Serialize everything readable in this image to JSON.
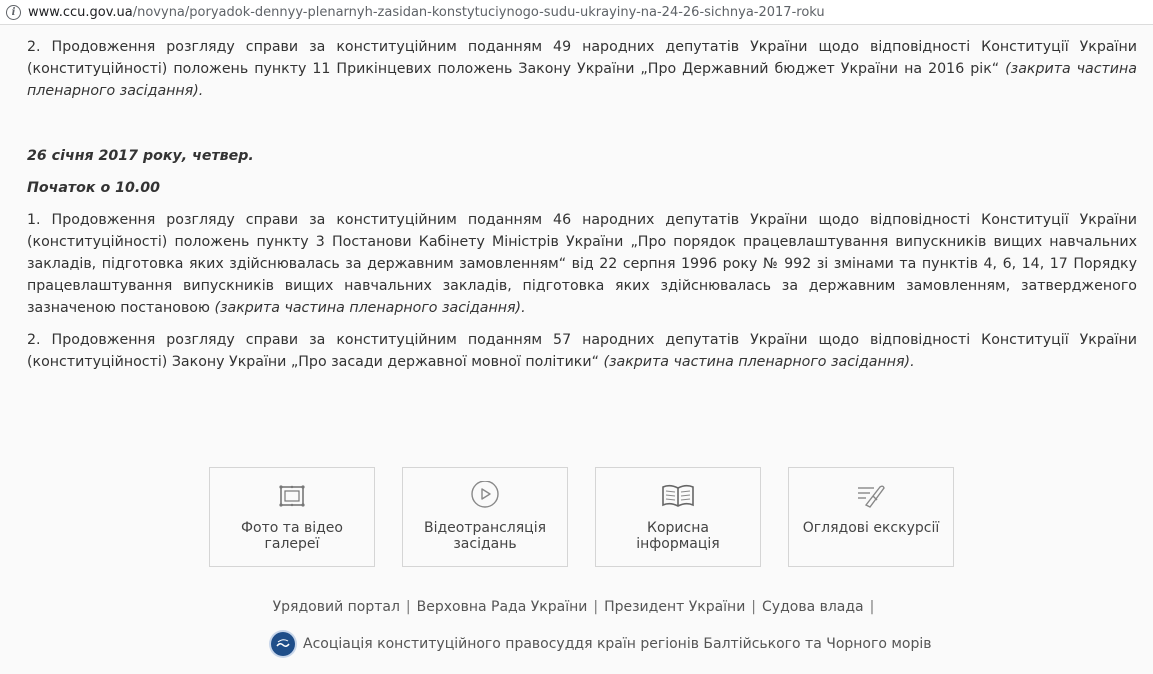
{
  "browser": {
    "url_host": "www.ccu.gov.ua",
    "url_path": "/novyna/poryadok-dennyy-plenarnyh-zasidan-konstytuciynogo-sudu-ukrayiny-na-24-26-sichnya-2017-roku"
  },
  "article": {
    "p2a_text": "2. Продовження розгляду справи за конституційним поданням 49 народних депутатів України щодо відповідності Конституції України (конституційності) положень пункту 11 Прикінцевих положень Закону України „Про Державний бюджет України на 2016 рік“ ",
    "p2a_note": "(закрита частина пленарного засідання).",
    "date_heading": "26 січня 2017 року, четвер.",
    "start_time": "Початок о 10.00",
    "p1_text": "1. Продовження розгляду справи за конституційним поданням 46 народних депутатів України щодо відповідності Конституції України (конституційності) положень пункту 3 Постанови Кабінету Міністрів України „Про порядок працевлаштування випускників вищих навчальних закладів, підготовка яких здійснювалась за державним замовленням“ від 22 серпня 1996 року №  992 зі змінами та пунктів 4, 6, 14, 17 Порядку працевлаштування випускників вищих навчальних закладів, підготовка яких здійснювалась за державним замовленням, затвердженого зазначеною постановою ",
    "p1_note": "(закрита частина пленарного засідання).",
    "p2b_text": "2. Продовження розгляду справи за конституційним поданням 57 народних депутатів України щодо відповідності Конституції України (конституційності) Закону України „Про засади державної мовної політики“ ",
    "p2b_note": "(закрита частина пленарного засідання)."
  },
  "tiles": [
    {
      "label_line1": "Фото та відео",
      "label_line2": "галереї",
      "icon": "photo-frame-icon"
    },
    {
      "label_line1": "Відеотрансляція",
      "label_line2": "засідань",
      "icon": "play-circle-icon"
    },
    {
      "label_line1": "Корисна",
      "label_line2": "інформація",
      "icon": "open-book-icon"
    },
    {
      "label_line1": "Оглядові екскурсії",
      "label_line2": "",
      "icon": "ticket-pen-icon"
    }
  ],
  "footer": {
    "links": [
      "Урядовий портал",
      "Верховна Рада України",
      "Президент України",
      "Судова влада"
    ],
    "separator": "|",
    "association": "Асоціація конституційного правосуддя країн регіонів Балтійського та Чорного морів",
    "association_icon": "association-logo-icon",
    "colors": {
      "text": "#333333",
      "footer_text": "#555555",
      "tile_border": "#d5d5d5",
      "logo": "#1f4e89"
    }
  }
}
